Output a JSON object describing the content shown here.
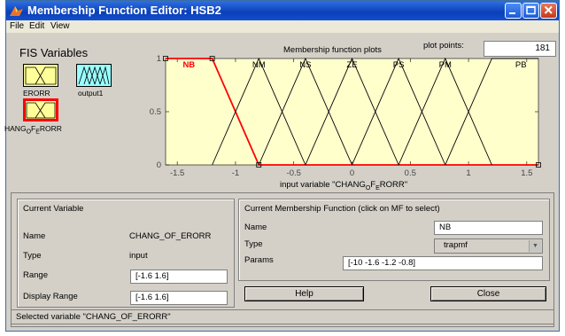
{
  "window": {
    "title": "Membership Function Editor: HSB2"
  },
  "menu": [
    "File",
    "Edit",
    "View"
  ],
  "fis_variables": {
    "heading": "FIS Variables",
    "items": [
      {
        "label": "ERORR",
        "color": "#ffff99"
      },
      {
        "label": "output1",
        "color": "#99ffff"
      },
      {
        "label": "CHANG_OF_ERORR",
        "label_base1": "HANG",
        "label_sub1": "O",
        "label_mid": "F",
        "label_sub2": "E",
        "label_end": "RORR",
        "color": "#ffff99",
        "selected": true,
        "selected_border": "#ff0000"
      }
    ]
  },
  "plot": {
    "title": "Membership function plots",
    "plot_points_label": "plot points:",
    "plot_points_value": "181",
    "xlabel_prefix": "input variable \"CHANG",
    "xlabel_sub1": "O",
    "xlabel_mid": "F",
    "xlabel_sub2": "E",
    "xlabel_suffix": "RORR\"",
    "x_ticks": [
      "-1.5",
      "-1",
      "-0.5",
      "0",
      "0.5",
      "1",
      "1.5"
    ],
    "y_ticks": [
      "0",
      "0.5",
      "1"
    ],
    "background": "#ffffcc"
  },
  "chart_data": {
    "type": "line",
    "xlim": [
      -1.6,
      1.6
    ],
    "ylim": [
      0,
      1
    ],
    "series": [
      {
        "name": "NB",
        "shape": "trapmf",
        "points": [
          [
            -1.6,
            1
          ],
          [
            -1.2,
            1
          ],
          [
            -0.8,
            0
          ],
          [
            1.6,
            0
          ]
        ],
        "selected": true
      },
      {
        "name": "NM",
        "points": [
          [
            -1.2,
            0
          ],
          [
            -0.8,
            1
          ],
          [
            -0.4,
            0
          ]
        ]
      },
      {
        "name": "NS",
        "points": [
          [
            -0.8,
            0
          ],
          [
            -0.4,
            1
          ],
          [
            0,
            0
          ]
        ]
      },
      {
        "name": "ZE",
        "points": [
          [
            -0.4,
            0
          ],
          [
            0,
            1
          ],
          [
            0.4,
            0
          ]
        ]
      },
      {
        "name": "PS",
        "points": [
          [
            0,
            0
          ],
          [
            0.4,
            1
          ],
          [
            0.8,
            0
          ]
        ]
      },
      {
        "name": "PM",
        "points": [
          [
            0.4,
            0
          ],
          [
            0.8,
            1
          ],
          [
            1.2,
            0
          ]
        ]
      },
      {
        "name": "PB",
        "points": [
          [
            0.8,
            0
          ],
          [
            1.2,
            1
          ],
          [
            1.6,
            1
          ]
        ]
      }
    ],
    "selected_color": "#ff0000",
    "line_color": "#000000"
  },
  "current_variable": {
    "heading": "Current Variable",
    "name_label": "Name",
    "name_value": "CHANG_OF_ERORR",
    "type_label": "Type",
    "type_value": "input",
    "range_label": "Range",
    "range_value": "[-1.6 1.6]",
    "display_range_label": "Display Range",
    "display_range_value": "[-1.6 1.6]"
  },
  "current_mf": {
    "heading": "Current Membership Function (click on MF to select)",
    "name_label": "Name",
    "name_value": "NB",
    "type_label": "Type",
    "type_value": "trapmf",
    "params_label": "Params",
    "params_value": "[-10 -1.6 -1.2 -0.8]"
  },
  "buttons": {
    "help": "Help",
    "close": "Close"
  },
  "status": "Selected variable \"CHANG_OF_ERORR\""
}
